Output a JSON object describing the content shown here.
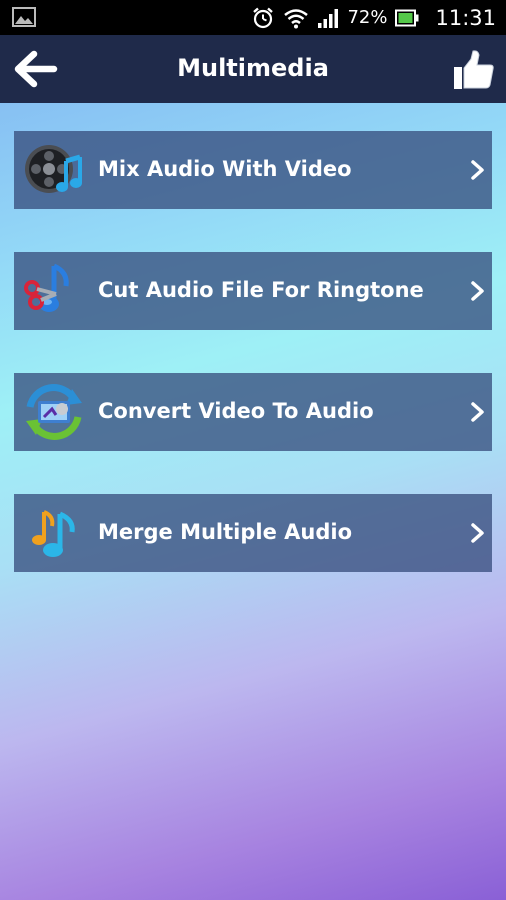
{
  "status_bar": {
    "battery_percent": "72%",
    "time": "11:31",
    "icons": [
      "gallery-icon",
      "alarm-clock-icon",
      "wifi-icon",
      "signal-icon",
      "battery-icon"
    ]
  },
  "app_bar": {
    "title": "Multimedia",
    "back_icon": "back-arrow-icon",
    "like_icon": "thumbs-up-icon"
  },
  "menu": {
    "items": [
      {
        "label": "Mix Audio With Video",
        "icon": "film-music-icon"
      },
      {
        "label": "Cut Audio File For Ringtone",
        "icon": "scissors-music-icon"
      },
      {
        "label": "Convert Video To Audio",
        "icon": "convert-video-icon"
      },
      {
        "label": "Merge Multiple Audio",
        "icon": "music-note-icon"
      }
    ]
  },
  "colors": {
    "app_bar": "#1f2a4a",
    "item_background": "#34497a",
    "text": "#ffffff"
  }
}
